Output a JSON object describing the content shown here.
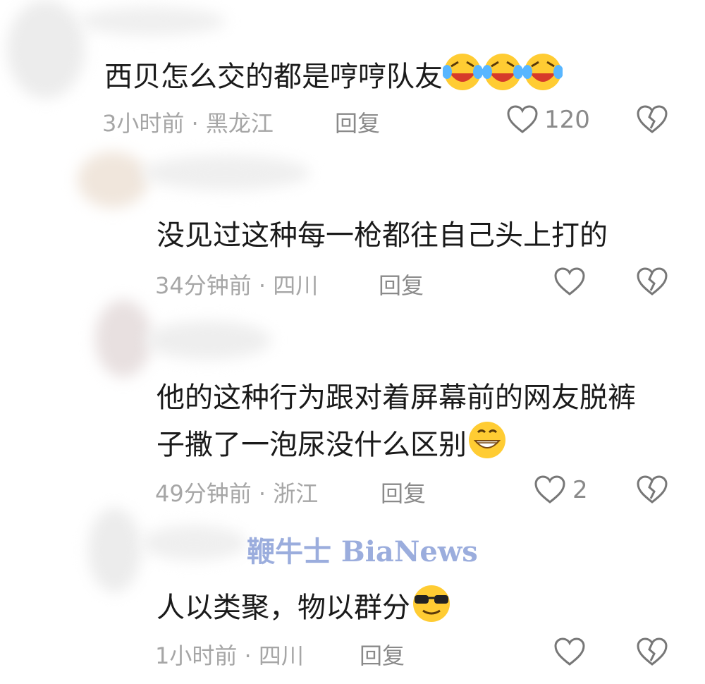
{
  "comments": [
    {
      "text": "西贝怎么交的都是哼哼队友",
      "emoji": "laugh-cry-icon",
      "time": "3小时前",
      "location": "黑龙江",
      "reply": "回复",
      "likes": "120"
    },
    {
      "text": "没见过这种每一枪都往自己头上打的",
      "time": "34分钟前",
      "location": "四川",
      "reply": "回复",
      "likes": ""
    },
    {
      "text_line1": "他的这种行为跟对着屏幕前的网友脱裤",
      "text_line2": "子撒了一泡尿没什么区别",
      "emoji": "grin-icon",
      "time": "49分钟前",
      "location": "浙江",
      "reply": "回复",
      "likes": "2"
    },
    {
      "text": "人以类聚，物以群分",
      "emoji": "sunglasses-icon",
      "time": "1小时前",
      "location": "四川",
      "reply": "回复",
      "likes": ""
    }
  ],
  "separator": "·",
  "watermark": "鞭牛士 BiaNews"
}
